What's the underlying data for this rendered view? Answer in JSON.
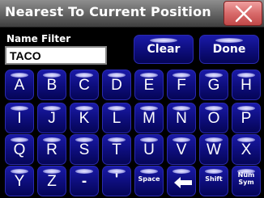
{
  "window": {
    "title": "Nearest To Current Position"
  },
  "filter": {
    "label": "Name Filter",
    "value": "TACO"
  },
  "actions": {
    "clear_label": "Clear",
    "done_label": "Done"
  },
  "keyboard": {
    "row1": [
      "A",
      "B",
      "C",
      "D",
      "E",
      "F",
      "G",
      "H"
    ],
    "row2": [
      "I",
      "J",
      "K",
      "L",
      "M",
      "N",
      "O",
      "P"
    ],
    "row3": [
      "Q",
      "R",
      "S",
      "T",
      "U",
      "V",
      "W",
      "X"
    ],
    "row4": {
      "y": "Y",
      "z": "Z",
      "dash": "-",
      "apostrophe": "'",
      "space": "Space",
      "backspace_icon": "backspace-arrow-icon",
      "shift": "Shift",
      "num_sym_line1": "Num",
      "num_sym_line2": "Sym"
    }
  },
  "colors": {
    "key_blue": "#0d0d7a",
    "close_red": "#d86a6a",
    "title_gray": "#6a6a6a"
  }
}
